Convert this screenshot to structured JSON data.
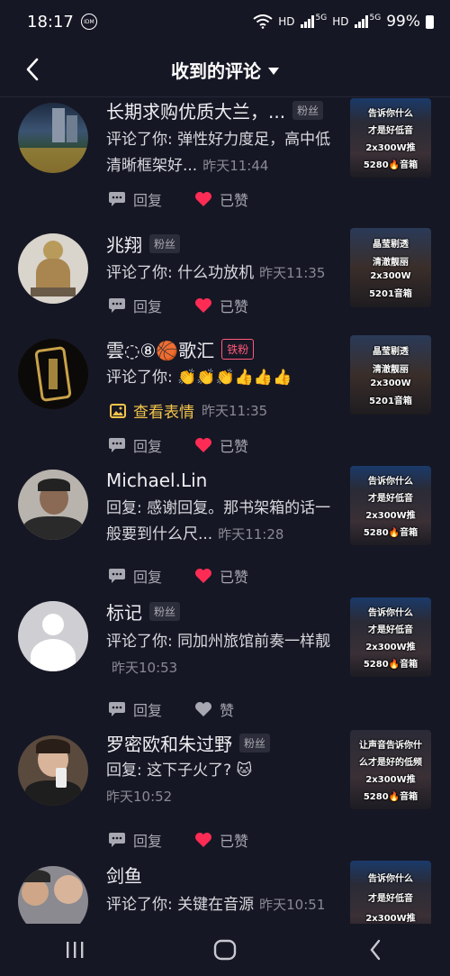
{
  "status": {
    "time": "18:17",
    "idm": "IDM",
    "hd1": "HD",
    "hd2": "HD",
    "net1": "5G",
    "net2": "5G",
    "battery": "99%"
  },
  "header": {
    "title": "收到的评论"
  },
  "labels": {
    "reply": "回复",
    "liked": "已赞",
    "like": "赞"
  },
  "comments": [
    {
      "name": "长期求购优质大兰，...",
      "badge": "粉丝",
      "text": "评论了你: 弹性好力度足，高中低清晰框架好...",
      "time": "昨天11:44",
      "liked": true,
      "thumb": [
        "告诉你什么",
        "才是好低音",
        "2x300W推",
        "5280🔥音箱"
      ]
    },
    {
      "name": "兆翔",
      "badge": "粉丝",
      "text": "评论了你: 什么功放机",
      "time": "昨天11:35",
      "liked": true,
      "thumb": [
        "晶莹剔透",
        "清澈靓丽",
        "2x300W",
        "5201音箱"
      ]
    },
    {
      "name": "雲◌⑧🏀歌汇",
      "badge": "铁粉",
      "text": "评论了你: 👏👏👏👍👍👍",
      "time": "昨天11:35",
      "sticker": "查看表情",
      "liked": true,
      "thumb": [
        "晶莹剔透",
        "清澈靓丽",
        "2x300W",
        "5201音箱"
      ]
    },
    {
      "name": "Michael.Lin",
      "badge": "",
      "text": "回复: 感谢回复。那书架箱的话一般要到什么尺...",
      "time": "昨天11:28",
      "liked": true,
      "thumb": [
        "告诉你什么",
        "才是好低音",
        "2x300W推",
        "5280🔥音箱"
      ]
    },
    {
      "name": "标记",
      "badge": "粉丝",
      "text": "评论了你: 同加州旅馆前奏一样靓",
      "time": "昨天10:53",
      "liked": false,
      "thumb": [
        "告诉你什么",
        "才是好低音",
        "2x300W推",
        "5280🔥音箱"
      ]
    },
    {
      "name": "罗密欧和朱过野",
      "badge": "粉丝",
      "text": "回复: 这下子火了? 🐱",
      "time": "昨天10:52",
      "liked": true,
      "thumb": [
        "让声音告诉你什",
        "么才是好的低频",
        "2x300W推",
        "5280🔥音箱"
      ]
    },
    {
      "name": "剑鱼",
      "badge": "",
      "text": "评论了你: 关键在音源",
      "time": "昨天10:51",
      "liked": false,
      "thumb": [
        "告诉你什么",
        "才是好低音",
        "2x300W推",
        ""
      ]
    }
  ],
  "colors": {
    "bg": "#161724",
    "heart_liked": "#fe2c55",
    "sticker": "#f3c44a",
    "iron_badge": "#ff5a7a"
  }
}
